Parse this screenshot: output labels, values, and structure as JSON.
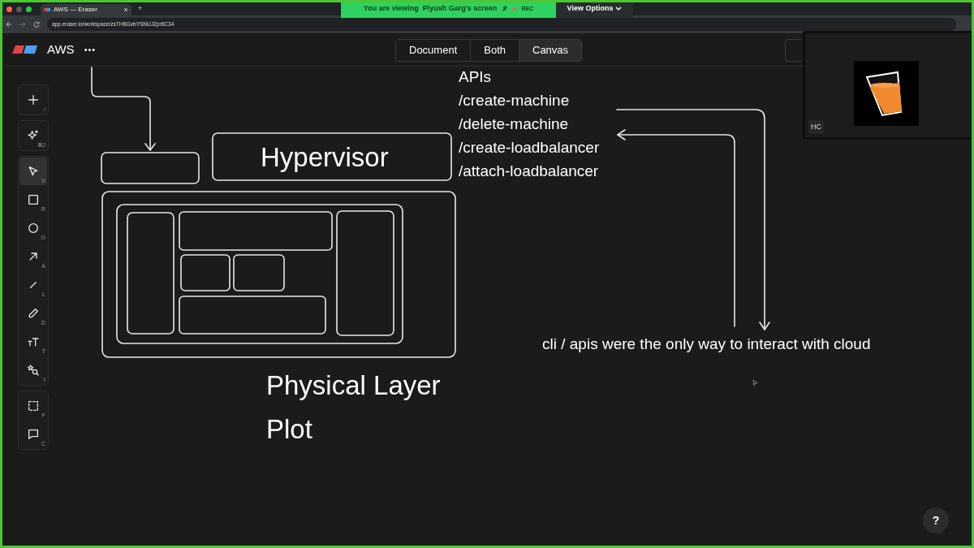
{
  "browser": {
    "tab_title": "AWS — Eraser",
    "new_tab": "+",
    "url": "app.eraser.io/workspace/zsTHBGvbYSNUJZpr6C34"
  },
  "share_banner": {
    "text": "You are viewing  Piyush Garg's screen",
    "rec": "REC",
    "view_options": "View Options"
  },
  "header": {
    "title": "AWS",
    "more": "•••",
    "modes": [
      {
        "label": "Document",
        "selected": false
      },
      {
        "label": "Both",
        "selected": false
      },
      {
        "label": "Canvas",
        "selected": true
      }
    ]
  },
  "video_tile": {
    "initials": "HC"
  },
  "tool_groups": [
    {
      "tools": [
        {
          "kind": "plus",
          "key": "/",
          "selected": false
        }
      ]
    },
    {
      "tools": [
        {
          "kind": "sparkle",
          "key": "⌘J",
          "selected": false
        }
      ]
    },
    {
      "tools": [
        {
          "kind": "pointer",
          "key": "V",
          "selected": true
        },
        {
          "kind": "square",
          "key": "R",
          "selected": false
        },
        {
          "kind": "circle",
          "key": "O",
          "selected": false
        },
        {
          "kind": "arrow",
          "key": "A",
          "selected": false
        },
        {
          "kind": "line",
          "key": "L",
          "selected": false
        },
        {
          "kind": "pencil",
          "key": "D",
          "selected": false
        },
        {
          "kind": "text",
          "key": "T",
          "selected": false
        },
        {
          "kind": "shapes",
          "key": "I",
          "selected": false
        }
      ]
    },
    {
      "tools": [
        {
          "kind": "frame",
          "key": "F",
          "selected": false
        },
        {
          "kind": "comment",
          "key": "C",
          "selected": false
        }
      ]
    }
  ],
  "canvas": {
    "hypervisor": "Hypervisor",
    "apis": [
      "APIs",
      "/create-machine",
      "/delete-machine",
      "/create-loadbalancer",
      "/attach-loadbalancer"
    ],
    "layer_labels": [
      "Physical Layer",
      "Plot"
    ],
    "note": "cli / apis were the only way to interact with cloud"
  },
  "help": "?"
}
